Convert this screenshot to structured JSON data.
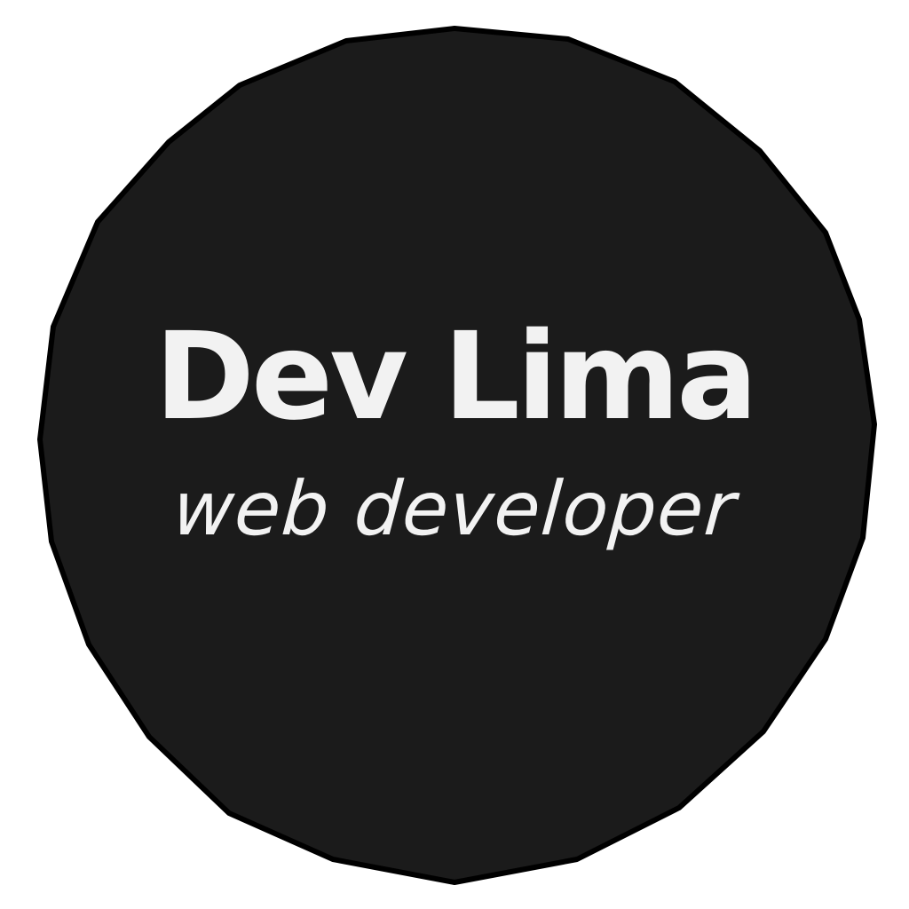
{
  "logo": {
    "name": "Dev Lima",
    "tagline": "web developer",
    "background_color": "#1b1b1b",
    "text_color": "#f2f2f2",
    "page_color": "#ffffff"
  }
}
